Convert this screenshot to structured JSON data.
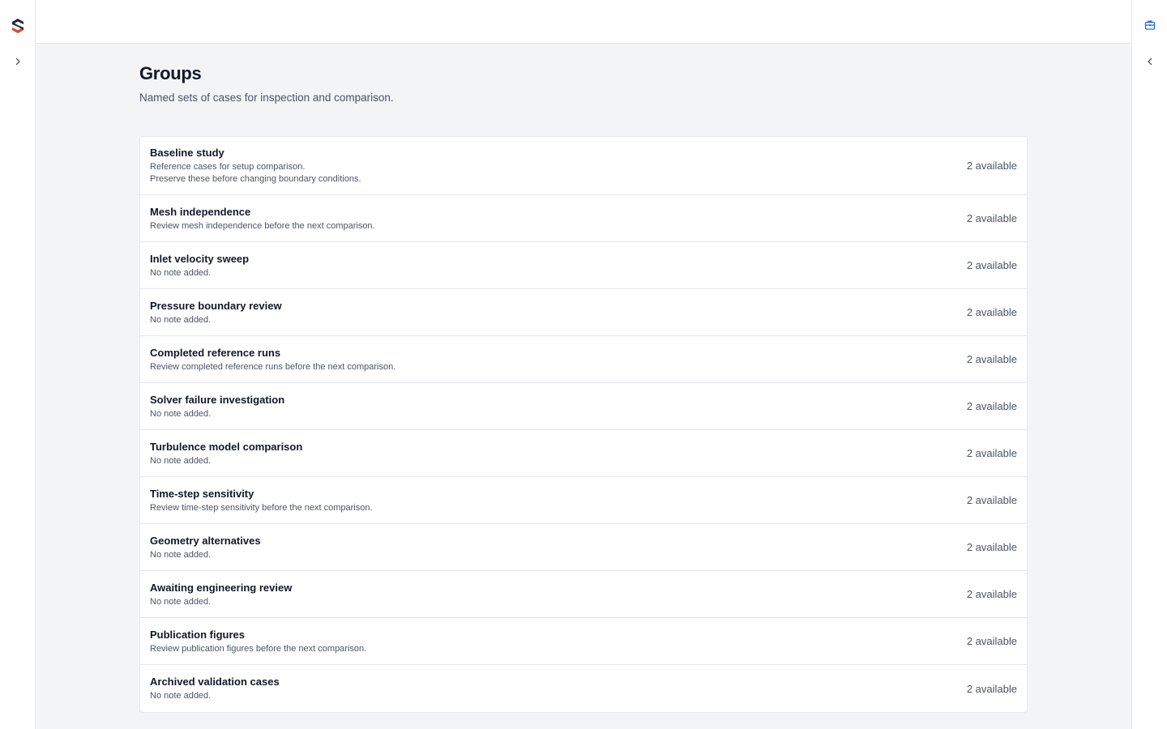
{
  "left_rail": {
    "logo_icon": "brand-logo-icon",
    "expand_icon": "chevron-right-icon"
  },
  "right_rail": {
    "toolbox_icon": "toolbox-icon",
    "collapse_icon": "chevron-left-icon"
  },
  "colors": {
    "logo_dark": "#1f2937",
    "logo_accent": "#dc4a26",
    "toolbox_blue": "#2563eb"
  },
  "page": {
    "title": "Groups",
    "subtitle": "Named sets of cases for inspection and comparison."
  },
  "groups": [
    {
      "name": "Baseline study",
      "notes": [
        "Reference cases for setup comparison.",
        "Preserve these before changing boundary conditions."
      ],
      "count": "2 available"
    },
    {
      "name": "Mesh independence",
      "notes": [
        "Review mesh independence before the next comparison."
      ],
      "count": "2 available"
    },
    {
      "name": "Inlet velocity sweep",
      "notes": [
        "No note added."
      ],
      "count": "2 available"
    },
    {
      "name": "Pressure boundary review",
      "notes": [
        "No note added."
      ],
      "count": "2 available"
    },
    {
      "name": "Completed reference runs",
      "notes": [
        "Review completed reference runs before the next comparison."
      ],
      "count": "2 available"
    },
    {
      "name": "Solver failure investigation",
      "notes": [
        "No note added."
      ],
      "count": "2 available"
    },
    {
      "name": "Turbulence model comparison",
      "notes": [
        "No note added."
      ],
      "count": "2 available"
    },
    {
      "name": "Time-step sensitivity",
      "notes": [
        "Review time-step sensitivity before the next comparison."
      ],
      "count": "2 available"
    },
    {
      "name": "Geometry alternatives",
      "notes": [
        "No note added."
      ],
      "count": "2 available"
    },
    {
      "name": "Awaiting engineering review",
      "notes": [
        "No note added."
      ],
      "count": "2 available"
    },
    {
      "name": "Publication figures",
      "notes": [
        "Review publication figures before the next comparison."
      ],
      "count": "2 available"
    },
    {
      "name": "Archived validation cases",
      "notes": [
        "No note added."
      ],
      "count": "2 available"
    }
  ]
}
